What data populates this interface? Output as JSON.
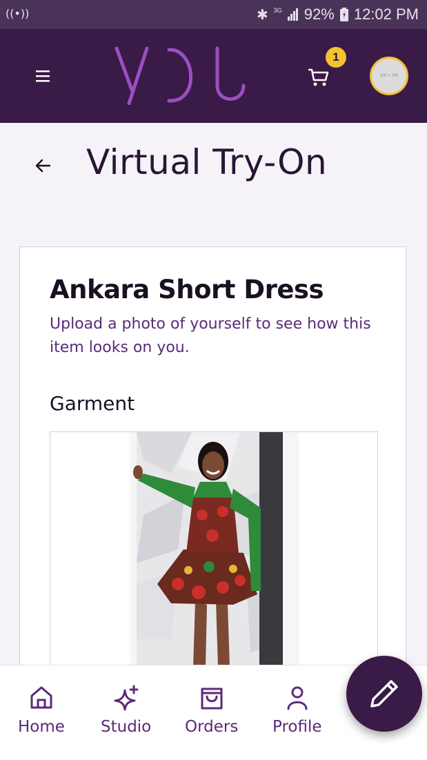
{
  "status_bar": {
    "battery": "92%",
    "time": "12:02 PM",
    "network": "3G"
  },
  "header": {
    "logo_text": "YOU",
    "cart_count": "1",
    "avatar_placeholder": "100 × 100"
  },
  "page": {
    "title": "Virtual Try-On"
  },
  "product": {
    "name": "Ankara Short Dress",
    "description": "Upload a photo of yourself to see how this item looks on you.",
    "section_label": "Garment"
  },
  "bottom_nav": {
    "items": [
      {
        "label": "Home",
        "icon": "home-icon"
      },
      {
        "label": "Studio",
        "icon": "sparkle-icon"
      },
      {
        "label": "Orders",
        "icon": "shopping-bag-icon"
      },
      {
        "label": "Profile",
        "icon": "profile-icon"
      }
    ]
  },
  "fab": {
    "icon": "pencil-icon"
  },
  "colors": {
    "header_bg": "#3a1a47",
    "accent": "#9b4fc0",
    "badge": "#f2c230",
    "nav_text": "#5a2a7a"
  }
}
